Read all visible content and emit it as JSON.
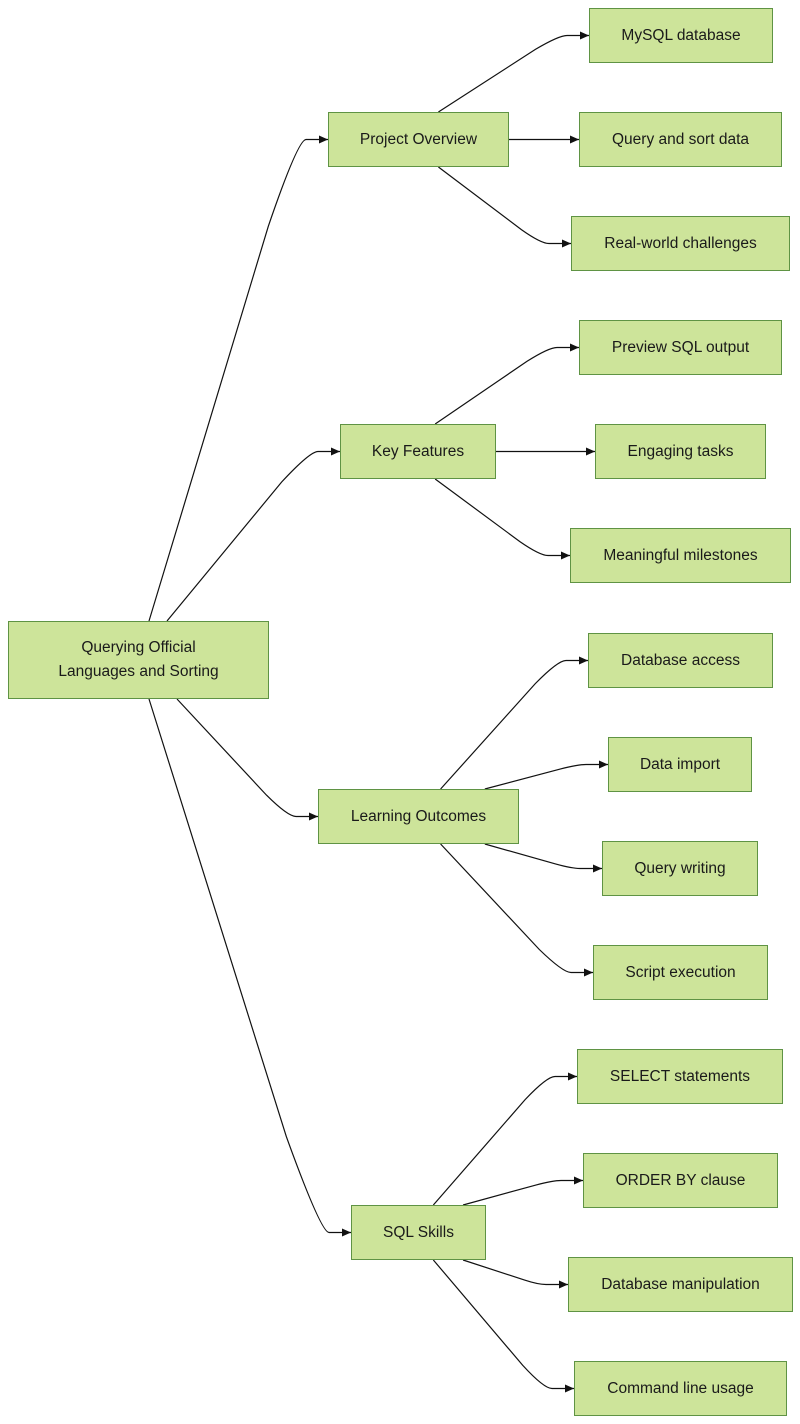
{
  "diagram": {
    "type": "mind-map",
    "colors": {
      "node_fill": "#cde49a",
      "node_border": "#5f9344",
      "edge": "#111111",
      "text": "#1a1a1a"
    },
    "root": {
      "id": "root",
      "label": "Querying Official\nLanguages and Sorting"
    },
    "branches": [
      {
        "id": "project-overview",
        "label": "Project Overview",
        "children": [
          {
            "id": "mysql-database",
            "label": "MySQL database"
          },
          {
            "id": "query-and-sort-data",
            "label": "Query and sort data"
          },
          {
            "id": "real-world-challenges",
            "label": "Real-world challenges"
          }
        ]
      },
      {
        "id": "key-features",
        "label": "Key Features",
        "children": [
          {
            "id": "preview-sql-output",
            "label": "Preview SQL output"
          },
          {
            "id": "engaging-tasks",
            "label": "Engaging tasks"
          },
          {
            "id": "meaningful-milestones",
            "label": "Meaningful milestones"
          }
        ]
      },
      {
        "id": "learning-outcomes",
        "label": "Learning Outcomes",
        "children": [
          {
            "id": "database-access",
            "label": "Database access"
          },
          {
            "id": "data-import",
            "label": "Data import"
          },
          {
            "id": "query-writing",
            "label": "Query writing"
          },
          {
            "id": "script-execution",
            "label": "Script execution"
          }
        ]
      },
      {
        "id": "sql-skills",
        "label": "SQL Skills",
        "children": [
          {
            "id": "select-statements",
            "label": "SELECT statements"
          },
          {
            "id": "order-by-clause",
            "label": "ORDER BY clause"
          },
          {
            "id": "database-manipulation",
            "label": "Database manipulation"
          },
          {
            "id": "command-line-usage",
            "label": "Command line usage"
          }
        ]
      }
    ]
  }
}
